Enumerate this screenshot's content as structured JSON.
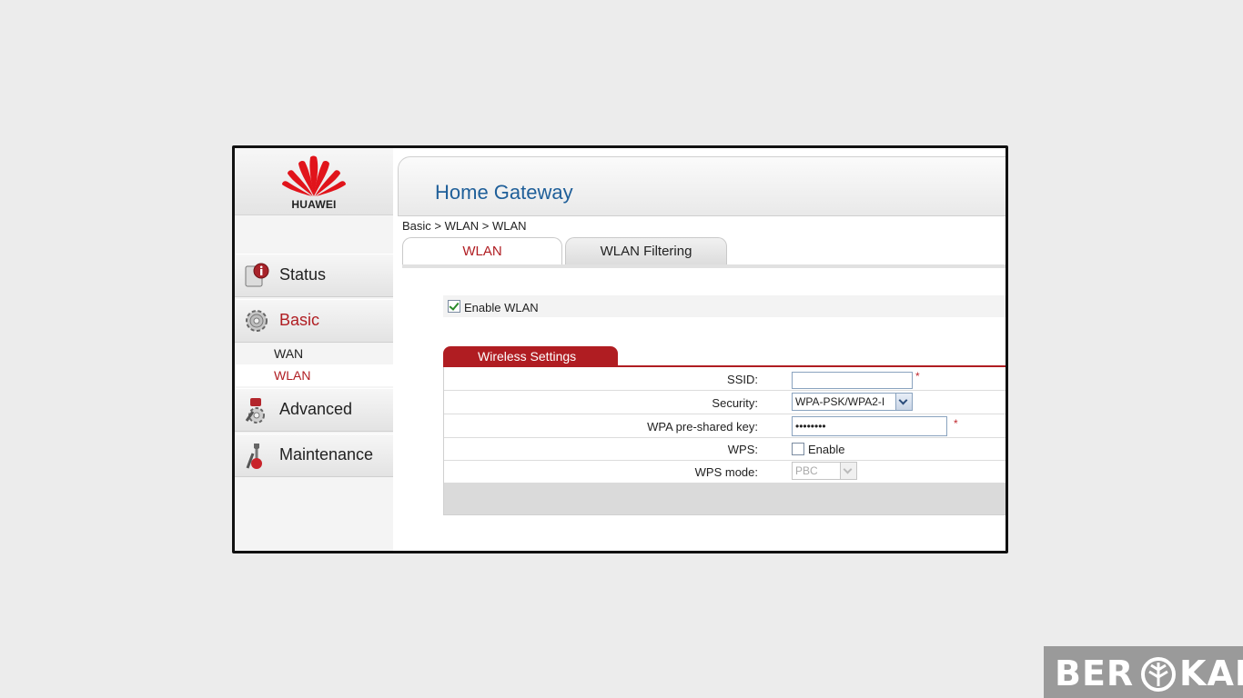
{
  "brand": {
    "name": "HUAWEI",
    "color": "#e1141b"
  },
  "sidebar": {
    "items": [
      {
        "label": "Status",
        "icon": "status-info-icon"
      },
      {
        "label": "Basic",
        "icon": "gear-icon",
        "active": true
      },
      {
        "label": "Advanced",
        "icon": "advanced-tools-icon"
      },
      {
        "label": "Maintenance",
        "icon": "maintenance-wrench-icon"
      }
    ],
    "subitems": [
      {
        "label": "WAN"
      },
      {
        "label": "WLAN",
        "active": true
      }
    ]
  },
  "header": {
    "title": "Home Gateway"
  },
  "breadcrumb": "Basic > WLAN > WLAN",
  "tabs": [
    {
      "label": "WLAN",
      "active": true
    },
    {
      "label": "WLAN Filtering"
    }
  ],
  "enable_wlan": {
    "label": "Enable WLAN",
    "checked": true
  },
  "wireless_settings": {
    "title": "Wireless Settings",
    "fields": {
      "ssid": {
        "label": "SSID:",
        "value": "",
        "required_mark": "*"
      },
      "security": {
        "label": "Security:",
        "value": "WPA-PSK/WPA2-I"
      },
      "psk": {
        "label": "WPA pre-shared key:",
        "value": "••••••••",
        "required_mark": "*"
      },
      "wps": {
        "label": "WPS:",
        "option_label": "Enable",
        "checked": false
      },
      "wps_mode": {
        "label": "WPS mode:",
        "value": "PBC"
      }
    }
  },
  "watermark": {
    "left": "BER",
    "right": "KAL"
  },
  "colors": {
    "accent": "#b01d22",
    "title_blue": "#1f5f99"
  }
}
